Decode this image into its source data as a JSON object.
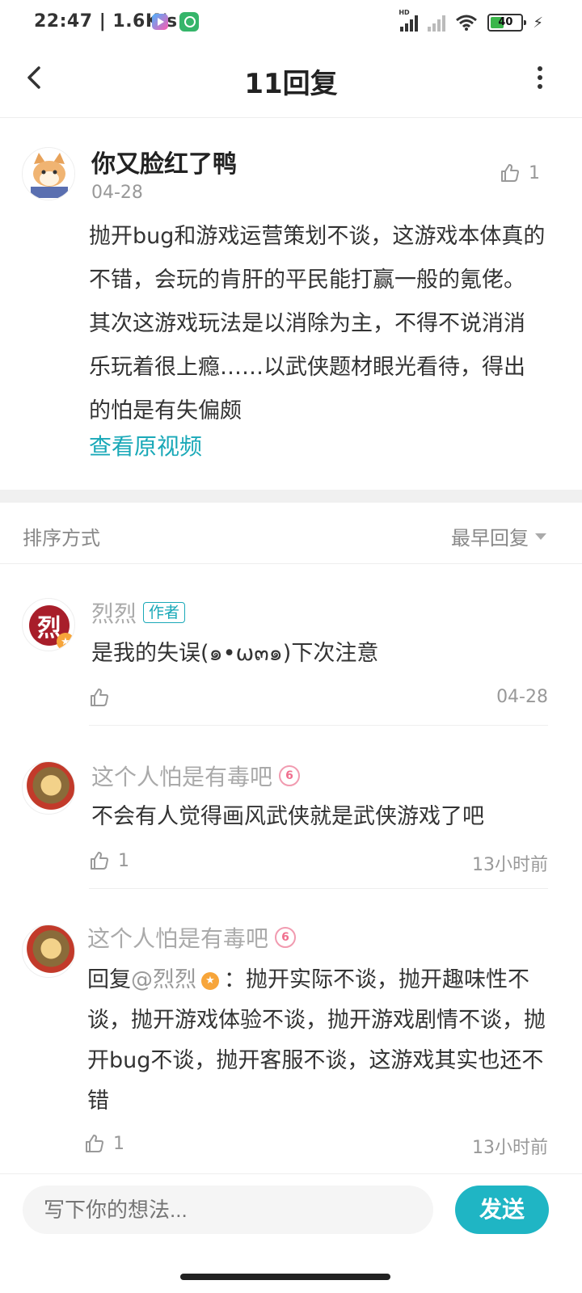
{
  "status_bar": {
    "time": "22:47",
    "speed": "1.6K/s",
    "battery": "40"
  },
  "navbar": {
    "title": "11回复"
  },
  "main_comment": {
    "username": "你又脸红了鸭",
    "date": "04-28",
    "likes": "1",
    "text": "抛开bug和游戏运营策划不谈，这游戏本体真的不错，会玩的肯肝的平民能打赢一般的氪佬。其次这游戏玩法是以消除为主，不得不说消消乐玩着很上瘾……以武侠题材眼光看待，得出的怕是有失偏颇",
    "view_video_link": "查看原视频"
  },
  "sort": {
    "label": "排序方式",
    "selected": "最早回复"
  },
  "replies": [
    {
      "username": "烈烈",
      "tag": "作者",
      "avatar_char": "烈",
      "text": "是我的失误(๑•ω๓๑)下次注意",
      "likes": "",
      "time": "04-28"
    },
    {
      "username": "这个人怕是有毒吧",
      "level_badge": "6",
      "text": "不会有人觉得画风武侠就是武侠游戏了吧",
      "likes": "1",
      "time": "13小时前"
    },
    {
      "username": "这个人怕是有毒吧",
      "level_badge": "6",
      "reply_prefix": "回复",
      "reply_to": "@烈烈",
      "text": "：抛开实际不谈，抛开趣味性不谈，抛开游戏体验不谈，抛开游戏剧情不谈，抛开bug不谈，抛开客服不谈，这游戏其实也还不错",
      "likes": "1",
      "time": "13小时前"
    }
  ],
  "input_bar": {
    "placeholder": "写下你的想法...",
    "send_label": "发送"
  },
  "colors": {
    "accent": "#1fb5c4",
    "link": "#1aa9b8",
    "author_gold": "#f7a53a"
  }
}
